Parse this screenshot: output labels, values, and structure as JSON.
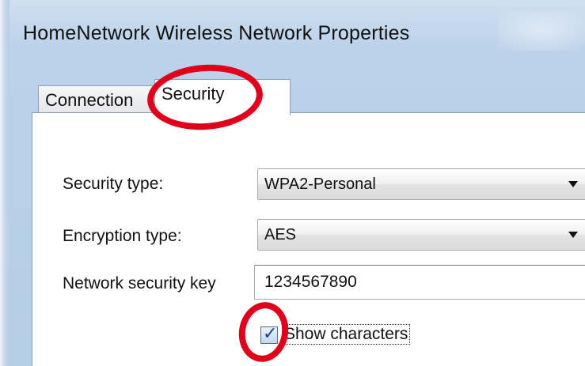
{
  "window": {
    "title": "HomeNetwork Wireless Network Properties"
  },
  "tabs": [
    {
      "label": "Connection",
      "selected": false
    },
    {
      "label": "Security",
      "selected": true
    }
  ],
  "security_type": {
    "label": "Security type:",
    "value": "WPA2-Personal"
  },
  "encryption_type": {
    "label": "Encryption type:",
    "value": "AES"
  },
  "network_key": {
    "label": "Network security key",
    "value": "1234567890"
  },
  "show_characters": {
    "label": "Show characters",
    "checked": true
  },
  "annotations": {
    "color": "#e0001b",
    "shape": "ellipse"
  },
  "colors": {
    "frame": "#b9cee5",
    "content_bg": "#ffffff"
  }
}
